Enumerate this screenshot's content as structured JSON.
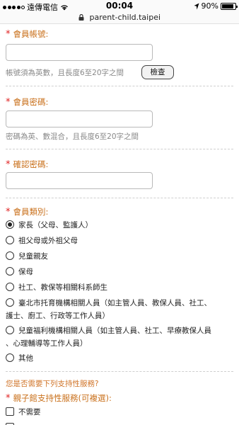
{
  "statusbar": {
    "carrier": "遠傳電信",
    "time": "00:04",
    "battery_percent": "90%",
    "battery_level": 0.9
  },
  "urlbar": {
    "url": "parent-child.taipei"
  },
  "form": {
    "required_mark": "*",
    "account": {
      "label": "會員帳號:",
      "hint": "帳號須為英數，且長度6至20字之間",
      "check_button": "檢查"
    },
    "password": {
      "label": "會員密碼:",
      "hint": "密碼為英、數混合，且長度6至20字之間"
    },
    "confirm": {
      "label": "確認密碼:"
    },
    "member_type": {
      "label": "會員類別:",
      "options": [
        {
          "line1": "家長（父母、監護人）",
          "checked": true
        },
        {
          "line1": "祖父母或外祖父母",
          "checked": false
        },
        {
          "line1": "兒童親友",
          "checked": false
        },
        {
          "line1": "保母",
          "checked": false
        },
        {
          "line1": "社工、教保等相關科系師生",
          "checked": false
        },
        {
          "line1": "臺北市托育機構相關人員（如主管人員、教保人員、社工、",
          "line2": "護士、廚工、行政等工作人員）",
          "checked": false
        },
        {
          "line1": "兒童福利機構相關人員（如主管人員、社工、早療教保人員",
          "line2": "、心理輔導等工作人員）",
          "checked": false
        },
        {
          "line1": "其他",
          "checked": false
        }
      ]
    },
    "support_question": "您是否需要下列支持性服務?",
    "support_services": {
      "label": "親子館支持性服務(可複選):",
      "options": [
        {
          "label": "不需要"
        }
      ]
    }
  }
}
